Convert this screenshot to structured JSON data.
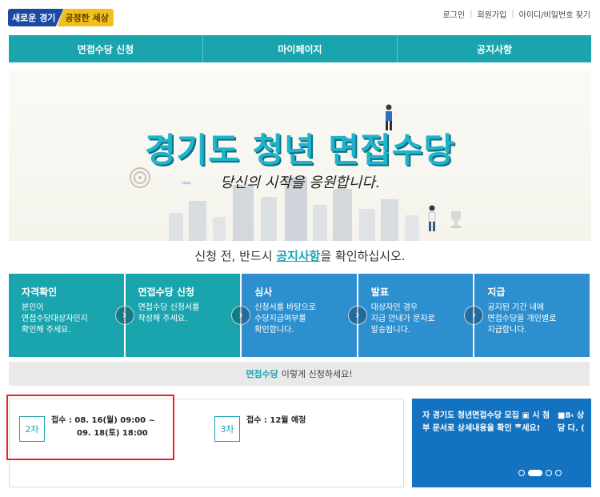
{
  "header": {
    "logo_part1": "새로운 경기",
    "logo_part2": "공정한 세상",
    "links": [
      "로그인",
      "회원가입",
      "아이디/비밀번호 찾기"
    ]
  },
  "nav": {
    "items": [
      "면접수당 신청",
      "마이페이지",
      "공지사항"
    ]
  },
  "hero": {
    "title": "경기도 청년 면접수당",
    "subtitle": "당신의 시작을 응원합니다."
  },
  "notice": {
    "before": "신청 전, 반드시 ",
    "link": "공지사항",
    "after": "을 확인하십시오."
  },
  "steps": [
    {
      "title": "자격확인",
      "desc": "본인이\n면접수당대상자인지\n확인해 주세요.",
      "color": "#1aa4ae"
    },
    {
      "title": "면접수당 신청",
      "desc": "면접수당 신청서를\n작성해 주세요.",
      "color": "#1aa4ae"
    },
    {
      "title": "심사",
      "desc": "신청서를 바탕으로\n수당지급여부를\n확인합니다.",
      "color": "#2e8fcf"
    },
    {
      "title": "발표",
      "desc": "대상자인 경우\n지급 안내가 문자로\n발송됩니다.",
      "color": "#2e8fcf"
    },
    {
      "title": "지급",
      "desc": "공지된 기간 내에\n면접수당을 개인별로\n지급합니다.",
      "color": "#2e8fcf"
    }
  ],
  "howto": {
    "highlight": "면접수당",
    "text": "이렇게 신청하세요!"
  },
  "schedule": [
    {
      "round": "2차",
      "line1": "접수 : 08. 16(월) 09:00 ~",
      "line2": "09. 18(토) 18:00"
    },
    {
      "round": "3차",
      "line1": "접수 : 12월 예정",
      "line2": ""
    }
  ],
  "banner": {
    "text": "자 경기도 청년면접수당 모집 ▣ 시 첨부 문서로 상세내용을 확인 ᄒ세요!",
    "side": "■8‹ 상담 다. (",
    "slide_count": 4,
    "active_slide": 1
  }
}
